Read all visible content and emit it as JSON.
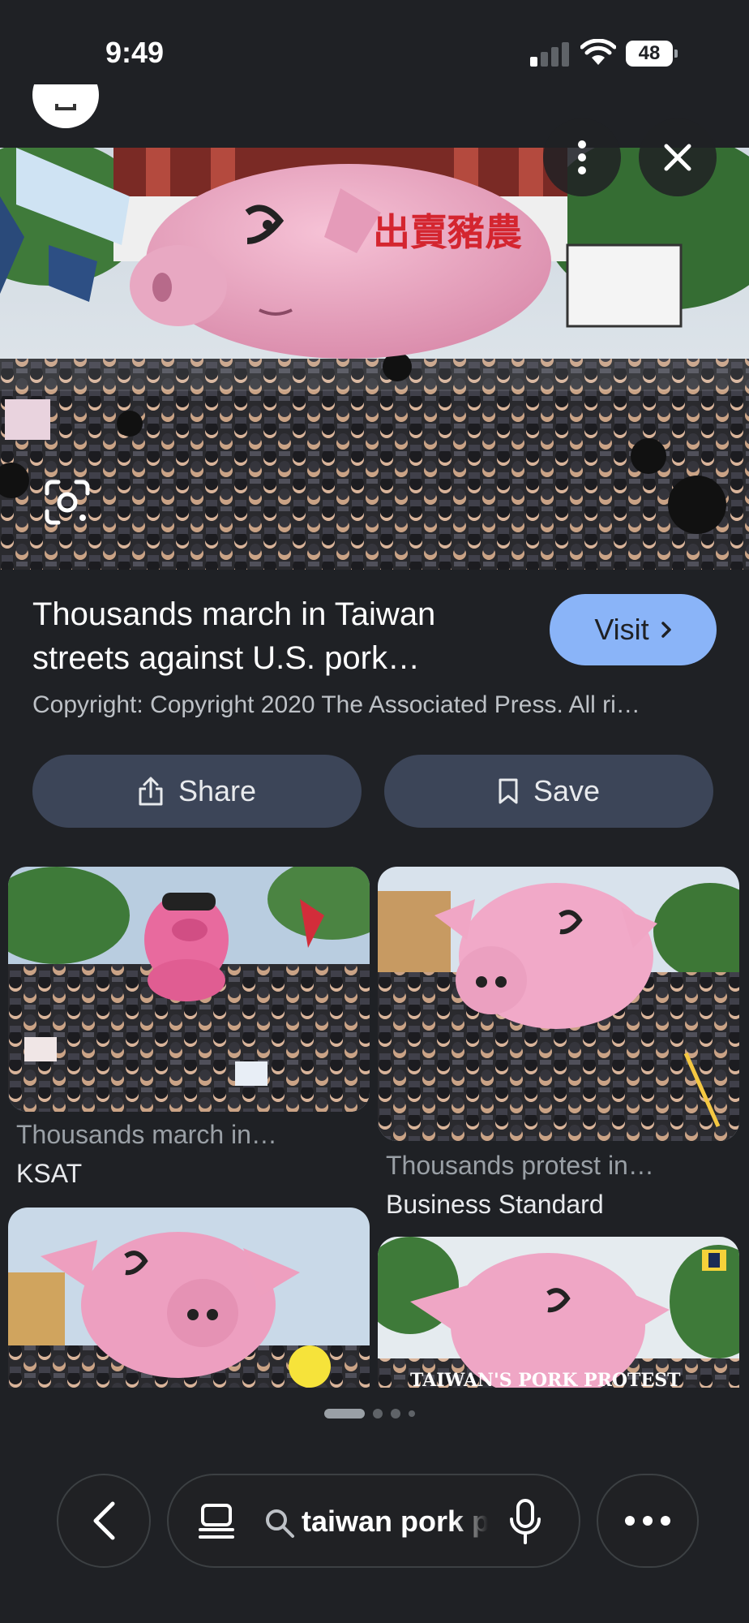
{
  "status_bar": {
    "time": "9:49",
    "battery": "48"
  },
  "result": {
    "title": "Thousands march in Taiwan streets against U.S. pork…",
    "visit_label": "Visit",
    "copyright": "Copyright: Copyright 2020 The Associated Press. All ri…",
    "share_label": "Share",
    "save_label": "Save",
    "banner_text": "出賣豬農"
  },
  "related": [
    {
      "title": "Thousands march in…",
      "source": "KSAT"
    },
    {
      "title": "Thousands protest in…",
      "source": "Business Standard"
    },
    {
      "title": "",
      "source": ""
    },
    {
      "title": "",
      "source": "",
      "overlay_text": "TAIWAN'S PORK PROTEST"
    }
  ],
  "pagination": {
    "active_index": 0,
    "count": 4
  },
  "bottom_bar": {
    "query": "taiwan pork protest"
  },
  "icons": [
    "lens-icon",
    "more-vert-icon",
    "close-icon",
    "share-icon",
    "bookmark-icon",
    "chevron-right-icon",
    "back-icon",
    "tabs-icon",
    "search-icon",
    "mic-icon",
    "more-horiz-icon"
  ],
  "colors": {
    "background": "#1f2125",
    "accent": "#8ab4f8",
    "pill": "#3c4558",
    "pig_pink": "#eba2c0"
  }
}
